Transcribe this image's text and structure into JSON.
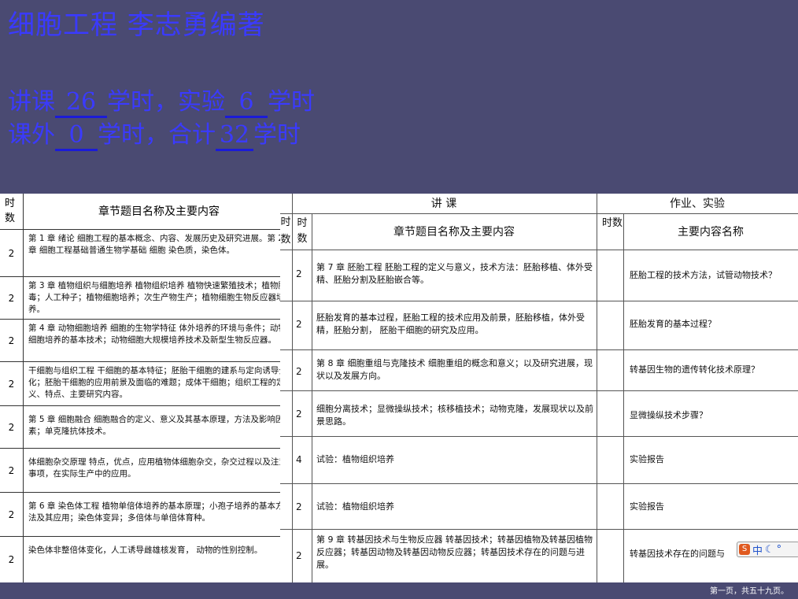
{
  "title": "细胞工程 李志勇编著",
  "hours": {
    "line1": {
      "a": "讲课",
      "lecture": "26",
      "b": "学时，实验",
      "lab": "6",
      "c": "学时"
    },
    "line2": {
      "a": "课外",
      "extra": "0",
      "b": "学时，合计",
      "total": "32",
      "c": "学时"
    }
  },
  "left_table": {
    "header_hours": "时数",
    "header_content": "章节题目名称及主要内容",
    "rows": [
      {
        "h": "2",
        "t": "第 1 章  绪论   细胞工程的基本概念、内容、发展历史及研究进展。第 2 章  细胞工程基础普通生物学基础   细胞  染色质，染色体。"
      },
      {
        "h": "2",
        "t": "第 3 章  植物组织与细胞培养  植物组织培养  植物快速繁殖技术；植物脱毒；人工种子；植物细胞培养；次生产物生产；植物细胞生物反应器培养。"
      },
      {
        "h": "2",
        "t": "第 4 章  动物细胞培养  细胞的生物学特征  体外培养的环境与条件；动物细胞培养的基本技术；动物细胞大规模培养技术及新型生物反应器。"
      },
      {
        "h": "2",
        "t": "干细胞与组织工程  干细胞的基本特征；胚胎干细胞的建系与定向诱导分化；胚胎干细胞的应用前景及面临的难题；成体干细胞；组织工程的定义、特点、主要研究内容。"
      },
      {
        "h": "2",
        "t": "第 5 章  细胞融合  细胞融合的定义、意义及其基本原理，方法及影响因素；单克隆抗体技术。"
      },
      {
        "h": "2",
        "t": "体细胞杂交原理  特点，优点，应用植物体细胞杂交，杂交过程以及注意事项，在实际生产中的应用。"
      },
      {
        "h": "2",
        "t": "第 6 章  染色体工程  植物单倍体培养的基本原理；小孢子培养的基本方法及其应用；染色体变异；多倍体与单倍体育种。"
      },
      {
        "h": "2",
        "t": "染色体非整倍体变化，人工诱导雌雄核发育，  动物的性别控制。"
      }
    ]
  },
  "right_table": {
    "group_lecture": "讲        课",
    "group_homework": "作业、实验",
    "header_hours": "时数",
    "header_content": "章节题目名称及主要内容",
    "header_hours2": "时数",
    "header_main": "主要内容名称",
    "rows": [
      {
        "h": "2",
        "content": "第 7 章  胚胎工程  胚胎工程的定义与意义，技术方法：胚胎移植、体外受精、胚胎分割及胚胎嵌合等。",
        "main": "胚胎工程的技术方法，试管动物技术？"
      },
      {
        "h": "2",
        "content": "胚胎发育的基本过程，胚胎工程的技术应用及前景，胚胎移植，体外受精，胚胎分割，  胚胎干细胞的研究及应用。",
        "main": "胚胎发育的基本过程？"
      },
      {
        "h": "2",
        "content": "第 8 章  细胞重组与克隆技术  细胞重组的概念和意义；以及研究进展，现状以及发展方向。",
        "main": "转基因生物的遗传转化技术原理？"
      },
      {
        "h": "2",
        "content": "细胞分离技术；显微操纵技术；核移植技术；动物克隆，发展现状以及前景思路。",
        "main": "显微操纵技术步骤？"
      },
      {
        "h": "4",
        "content": "试验：植物组织培养",
        "main": "实验报告"
      },
      {
        "h": "2",
        "content": "试验：植物组织培养",
        "main": "实验报告"
      },
      {
        "h": "2",
        "content": "第 9 章  转基因技术与生物反应器  转基因技术；转基因植物及转基因植物反应器；转基因动物及转基因动物反应器；转基因技术存在的问题与进展。",
        "main": "转基因技术存在的问题与"
      }
    ]
  },
  "ime": {
    "label": "中"
  },
  "footer": "第一页，共五十九页。"
}
